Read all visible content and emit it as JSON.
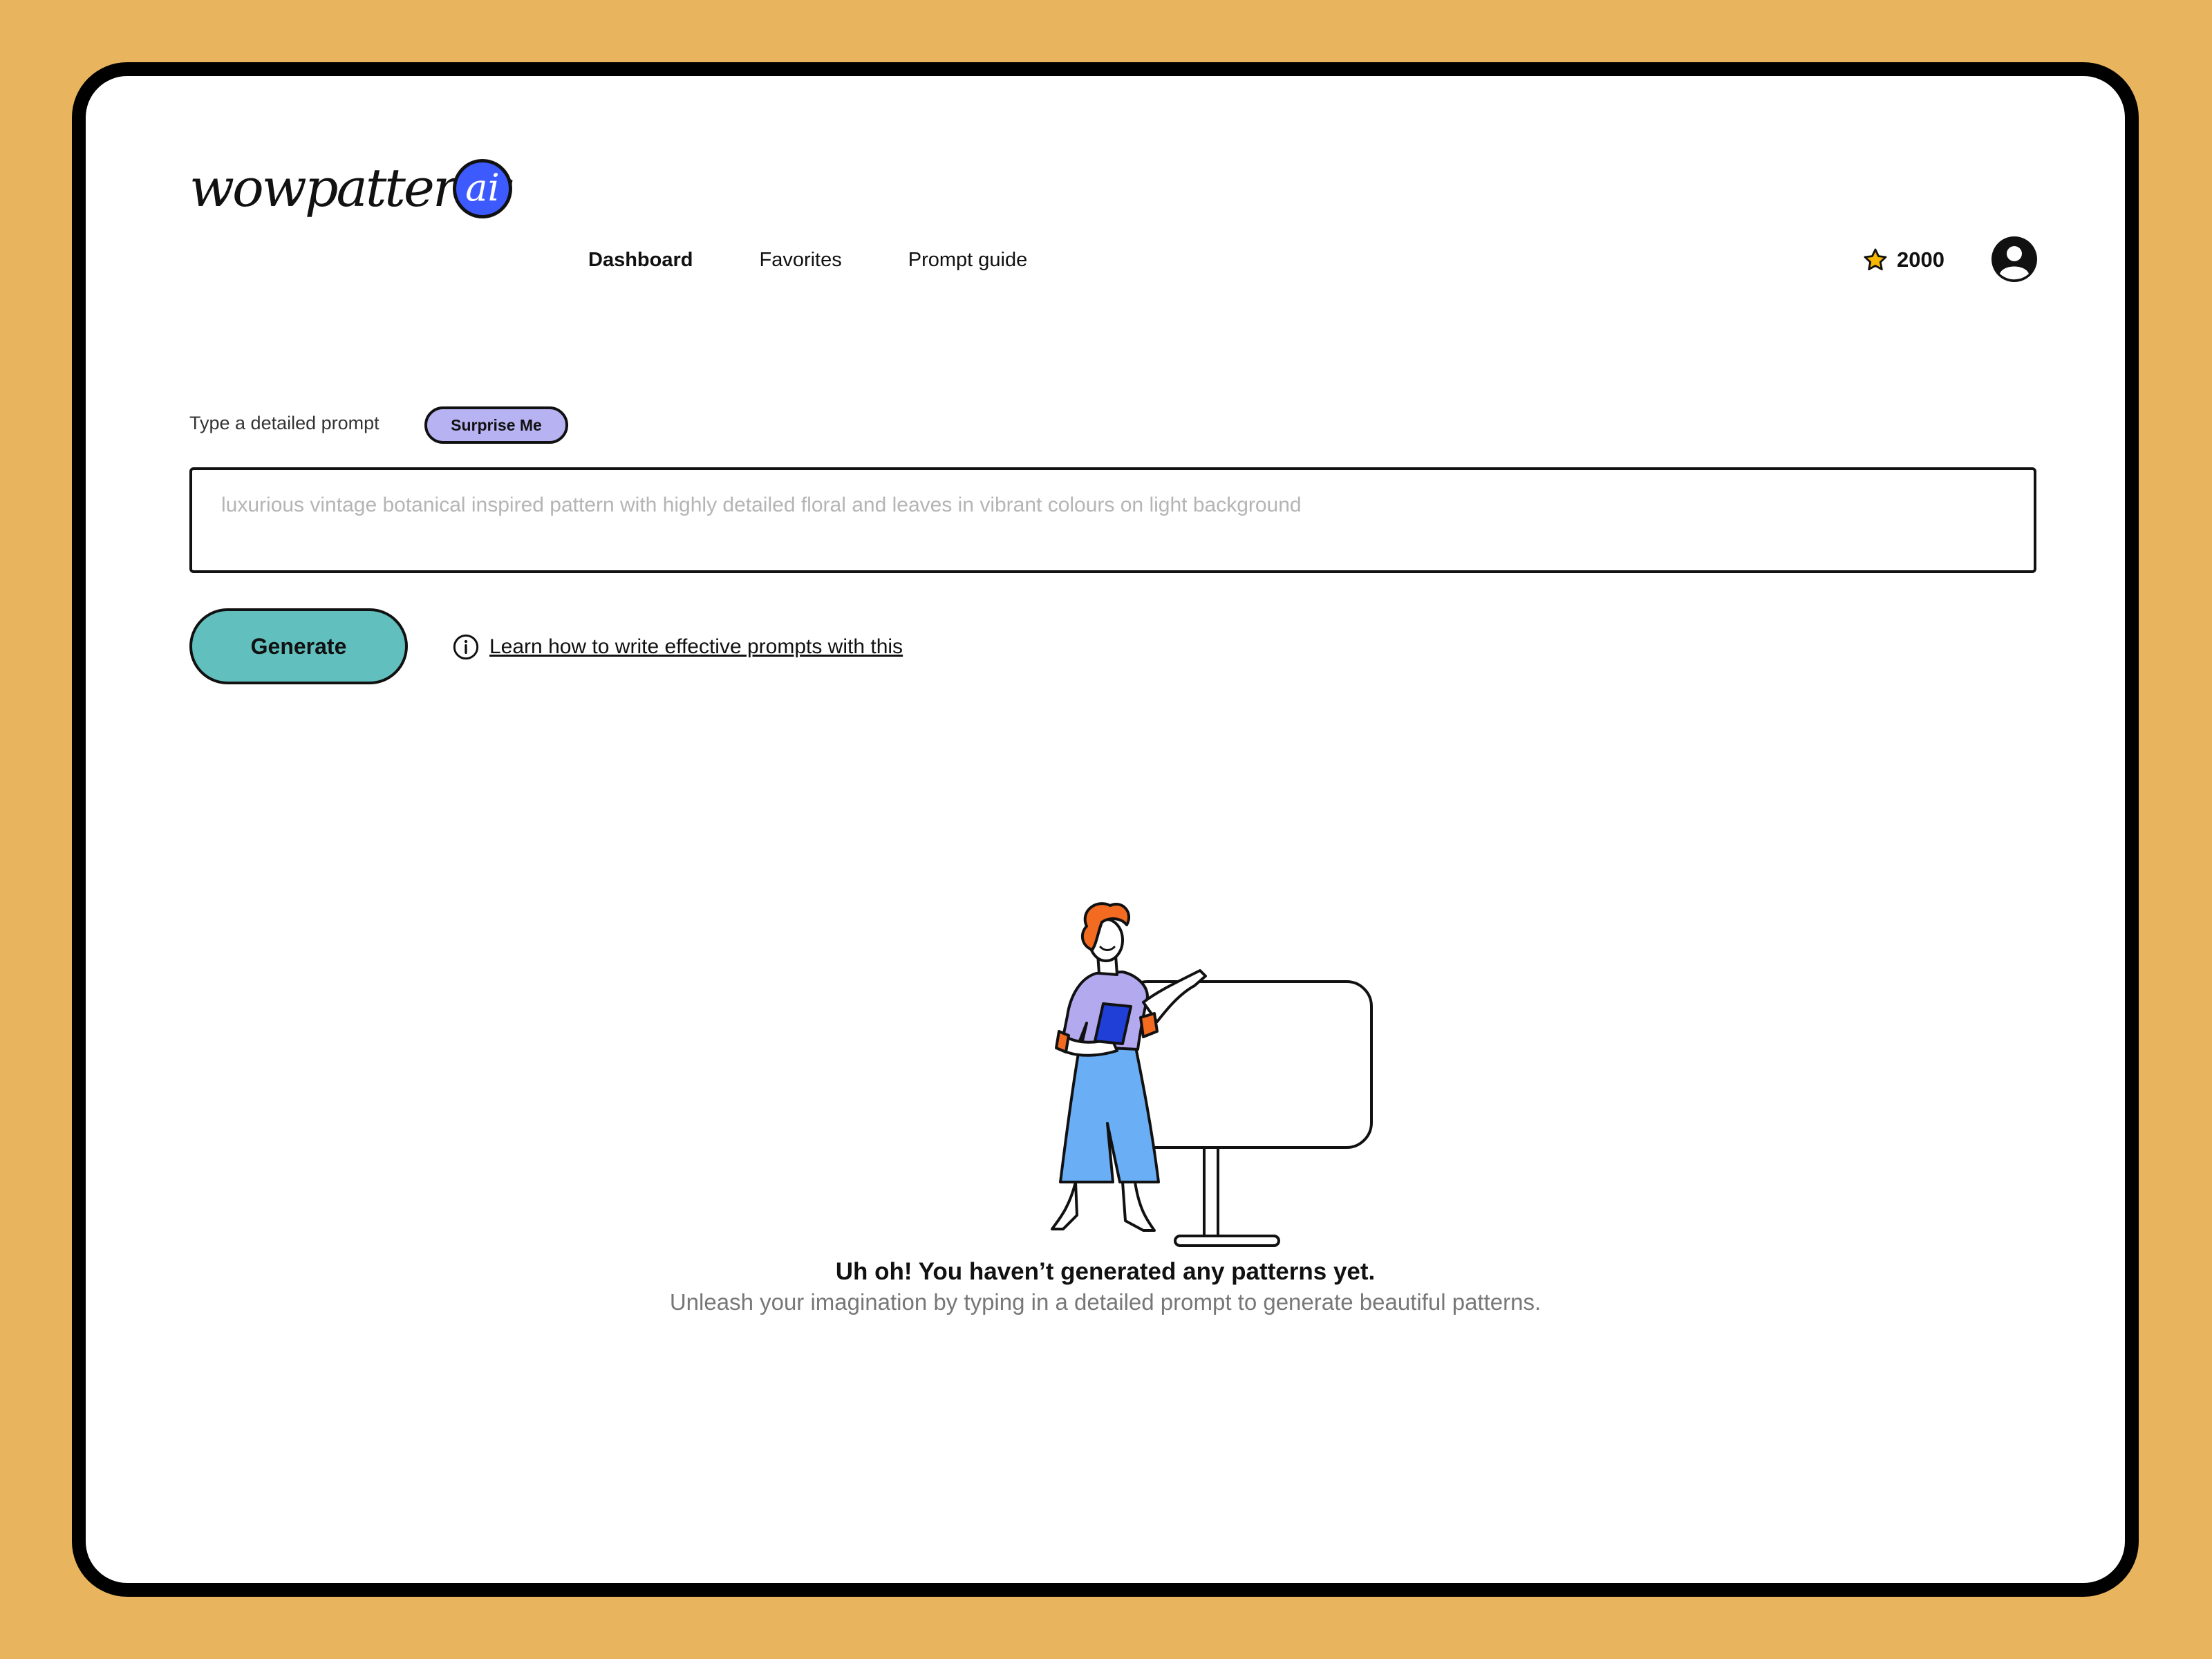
{
  "brand": {
    "name": "wowpatterns",
    "badge": "ai"
  },
  "nav": {
    "items": [
      {
        "label": "Dashboard",
        "active": true
      },
      {
        "label": "Favorites",
        "active": false
      },
      {
        "label": "Prompt guide",
        "active": false
      }
    ]
  },
  "credits": {
    "icon": "star-icon",
    "count": "2000"
  },
  "account": {
    "icon": "user-avatar-icon"
  },
  "prompt": {
    "label": "Type a detailed prompt",
    "surprise_label": "Surprise Me",
    "value": "",
    "placeholder": "luxurious vintage botanical inspired pattern with highly detailed floral and leaves in vibrant colours on light background"
  },
  "actions": {
    "generate_label": "Generate",
    "help_icon": "info-icon",
    "help_link": "Learn how to write effective prompts with this"
  },
  "empty_state": {
    "title": "Uh oh! You haven’t generated any patterns yet.",
    "subtitle": "Unleash your imagination by typing in a detailed prompt to generate beautiful patterns."
  },
  "colors": {
    "background": "#E8B45E",
    "device_frame": "#000000",
    "brand_badge": "#3D5AFE",
    "surprise_button": "#B7B3F2",
    "generate_button": "#61BFBD",
    "star": "#F5B700",
    "hair": "#F26B21",
    "shirt": "#B3A9EE",
    "pants": "#6AAEF5",
    "tablet": "#1F3FD6"
  }
}
